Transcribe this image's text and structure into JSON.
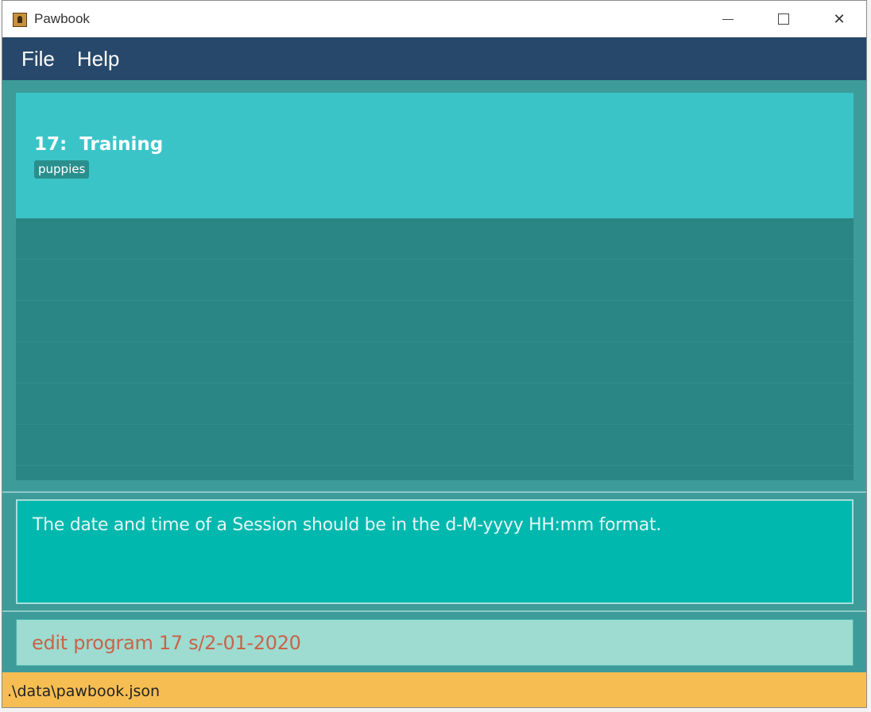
{
  "window": {
    "title": "Pawbook",
    "minimize_glyph": "",
    "close_glyph": "✕"
  },
  "menu": {
    "items": [
      "File",
      "Help"
    ]
  },
  "list": {
    "cards": [
      {
        "index": "17:",
        "name": "Training",
        "tags": [
          "puppies"
        ]
      }
    ]
  },
  "result": {
    "message": "The date and time of a Session should be in the d-M-yyyy HH:mm format."
  },
  "command": {
    "value": "edit program 17 s/2-01-2020"
  },
  "status": {
    "file_path": ".\\data\\pawbook.json"
  },
  "colors": {
    "menubar": "#27486a",
    "card": "#3bc4c8",
    "list_bg": "#2a8585",
    "result_bg": "#00b8ae",
    "command_bg": "#9edbd0",
    "command_text": "#c8644a",
    "statusbar": "#f6be52"
  },
  "icons": {
    "app": "pawbook-app-icon",
    "minimize": "minimize-icon",
    "maximize": "maximize-icon",
    "close": "close-icon"
  }
}
